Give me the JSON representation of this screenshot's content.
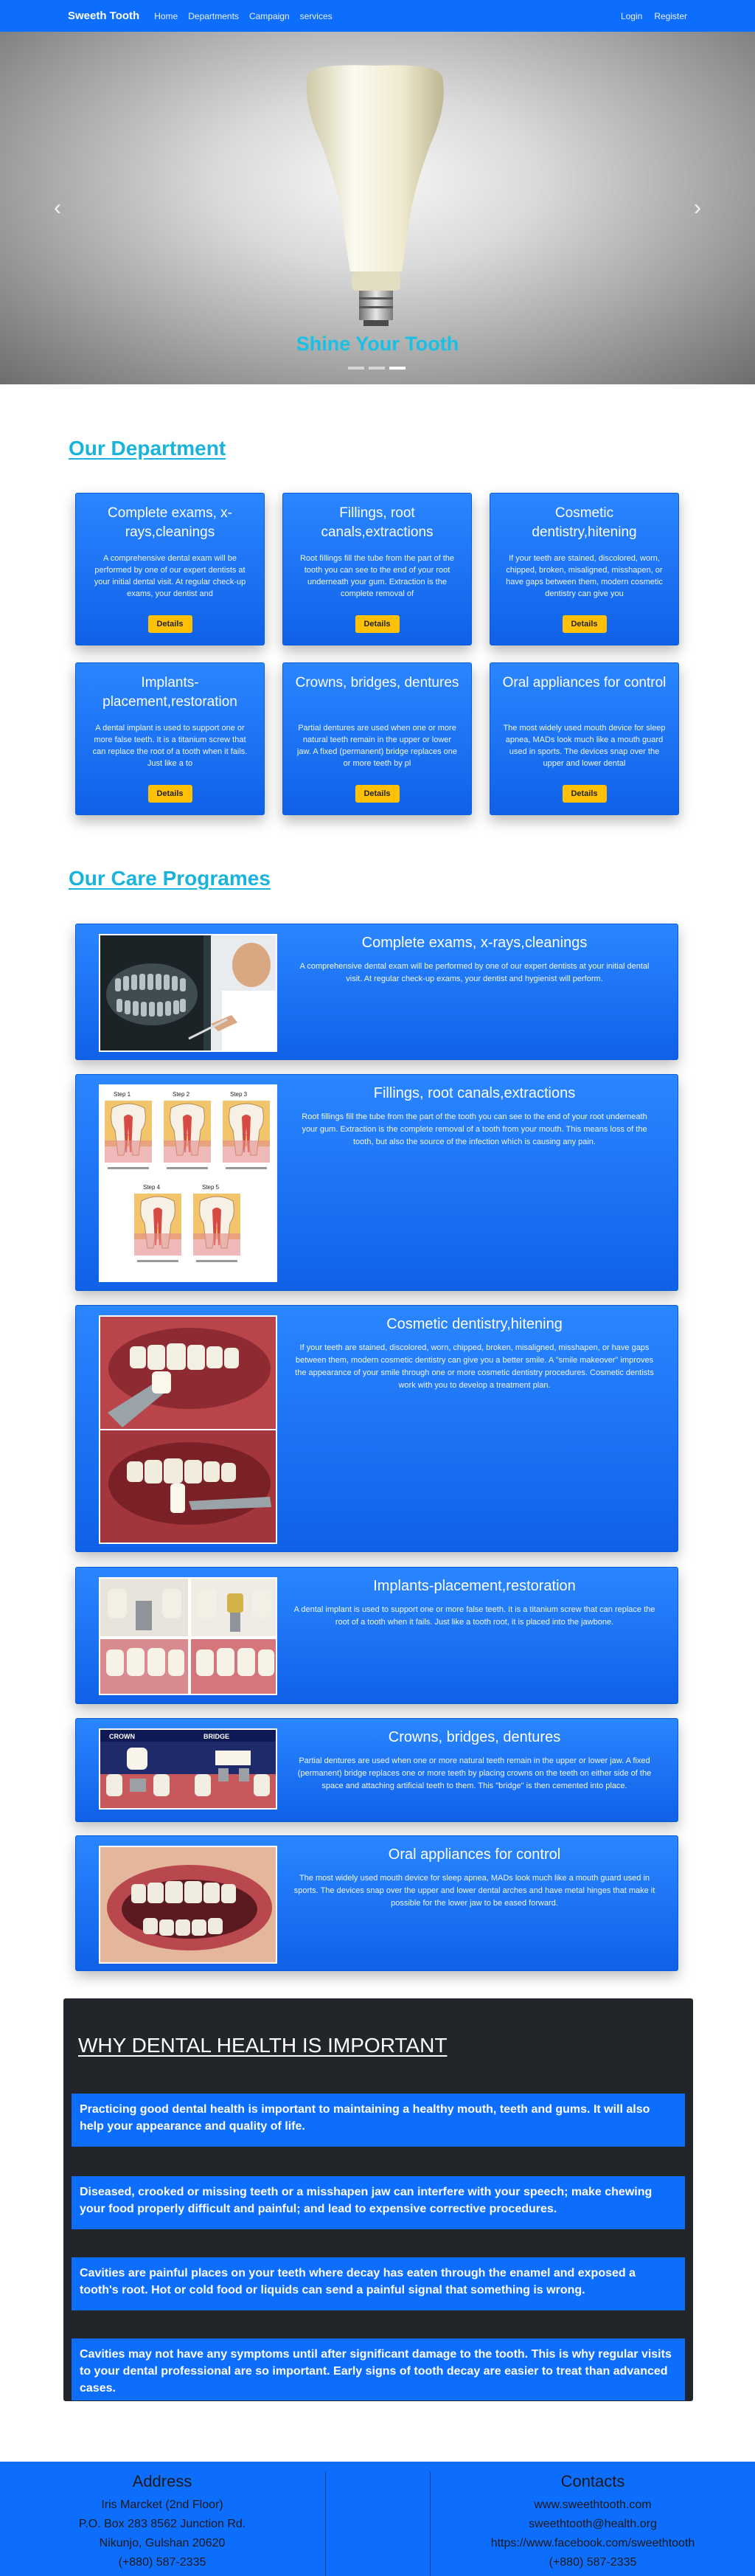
{
  "nav": {
    "brand": "Sweeth Tooth",
    "links": [
      "Home",
      "Departments",
      "Campaign",
      "services"
    ],
    "right": [
      "Login",
      "Register"
    ]
  },
  "hero": {
    "title": "Shine Your Tooth",
    "prev_icon": "chevron-left-icon",
    "next_icon": "chevron-right-icon",
    "slides": 3,
    "active_slide": 3
  },
  "department": {
    "title": "Our Department",
    "button_label": "Details",
    "cards": [
      {
        "title": "Complete exams, x-rays,cleanings",
        "text": "A comprehensive dental exam will be performed by one of our expert dentists at your initial dental visit. At regular check-up exams, your dentist and"
      },
      {
        "title": "Fillings, root canals,extractions",
        "text": "Root fillings fill the tube from the part of the tooth you can see to the end of your root underneath your gum. Extraction is the complete removal of"
      },
      {
        "title": "Cosmetic dentistry,hitening",
        "text": "If your teeth are stained, discolored, worn, chipped, broken, misaligned, misshapen, or have gaps between them, modern cosmetic dentistry can give you"
      },
      {
        "title": "Implants-placement,restoration",
        "text": "A dental implant is used to support one or more false teeth. It is a titanium screw that can replace the root of a tooth when it fails. Just like a to"
      },
      {
        "title": "Crowns, bridges, dentures",
        "text": "Partial dentures are used when one or more natural teeth remain in the upper or lower jaw. A fixed (permanent) bridge replaces one or more teeth by pl"
      },
      {
        "title": "Oral appliances for control",
        "text": "The most widely used mouth device for sleep apnea, MADs look much like a mouth guard used in sports. The devices snap over the upper and lower dental"
      }
    ]
  },
  "care": {
    "title": "Our Care Programes",
    "items": [
      {
        "title": "Complete exams, x-rays,cleanings",
        "text": "A comprehensive dental exam will be performed by one of our expert dentists at your initial dental visit. At regular check-up exams, your dentist and hygienist will perform."
      },
      {
        "title": "Fillings, root canals,extractions",
        "text": "Root fillings fill the tube from the part of the tooth you can see to the end of your root underneath your gum. Extraction is the complete removal of a tooth from your mouth. This means loss of the tooth, but also the source of the infection which is causing any pain.",
        "steps": [
          "Step 1",
          "Step 2",
          "Step 3",
          "Step 4",
          "Step 5"
        ]
      },
      {
        "title": "Cosmetic dentistry,hitening",
        "text": "If your teeth are stained, discolored, worn, chipped, broken, misaligned, misshapen, or have gaps between them, modern cosmetic dentistry can give you a better smile. A \"smile makeover\" improves the appearance of your smile through one or more cosmetic dentistry procedures. Cosmetic dentists work with you to develop a treatment plan."
      },
      {
        "title": "Implants-placement,restoration",
        "text": "A dental implant is used to support one or more false teeth. It is a titanium screw that can replace the root of a tooth when it fails. Just like a tooth root, it is placed into the jawbone."
      },
      {
        "title": "Crowns, bridges, dentures",
        "text": "Partial dentures are used when one or more natural teeth remain in the upper or lower jaw. A fixed (permanent) bridge replaces one or more teeth by placing crowns on the teeth on either side of the space and attaching artificial teeth to them. This \"bridge\" is then cemented into place.",
        "img_labels": [
          "CROWN",
          "BRIDGE"
        ]
      },
      {
        "title": "Oral appliances for control",
        "text": "The most widely used mouth device for sleep apnea, MADs look much like a mouth guard used in sports. The devices snap over the upper and lower dental arches and have metal hinges that make it possible for the lower jaw to be eased forward."
      }
    ]
  },
  "why": {
    "title": "WHY DENTAL HEALTH IS IMPORTANT",
    "points": [
      "Practicing good dental health is important to maintaining a healthy mouth, teeth and gums. It will also help your appearance and quality of life.",
      "Diseased, crooked or missing teeth or a misshapen jaw can interfere with your speech; make chewing your food properly difficult and painful; and lead to expensive corrective procedures.",
      "Cavities are painful places on your teeth where decay has eaten through the enamel and exposed a tooth's root. Hot or cold food or liquids can send a painful signal that something is wrong.",
      "Cavities may not have any symptoms until after significant damage to the tooth. This is why regular visits to your dental professional are so important. Early signs of tooth decay are easier to treat than advanced cases."
    ]
  },
  "footer": {
    "address_title": "Address",
    "address_lines": [
      "Iris Marcket (2nd Floor)",
      "P.O. Box 283 8562 Junction Rd.",
      "Nikunjo, Gulshan 20620",
      "(+880) 587-2335"
    ],
    "contacts_title": "Contacts",
    "contact_lines": [
      "www.sweethtooth.com",
      "sweethtooth@health.org",
      "https://www.facebook.com/sweethtooth",
      "(+880) 587-2335"
    ]
  },
  "colors": {
    "primary": "#0d6efd",
    "accent_title": "#19b3db",
    "button": "#ffc107",
    "dark_panel": "#22262b"
  }
}
